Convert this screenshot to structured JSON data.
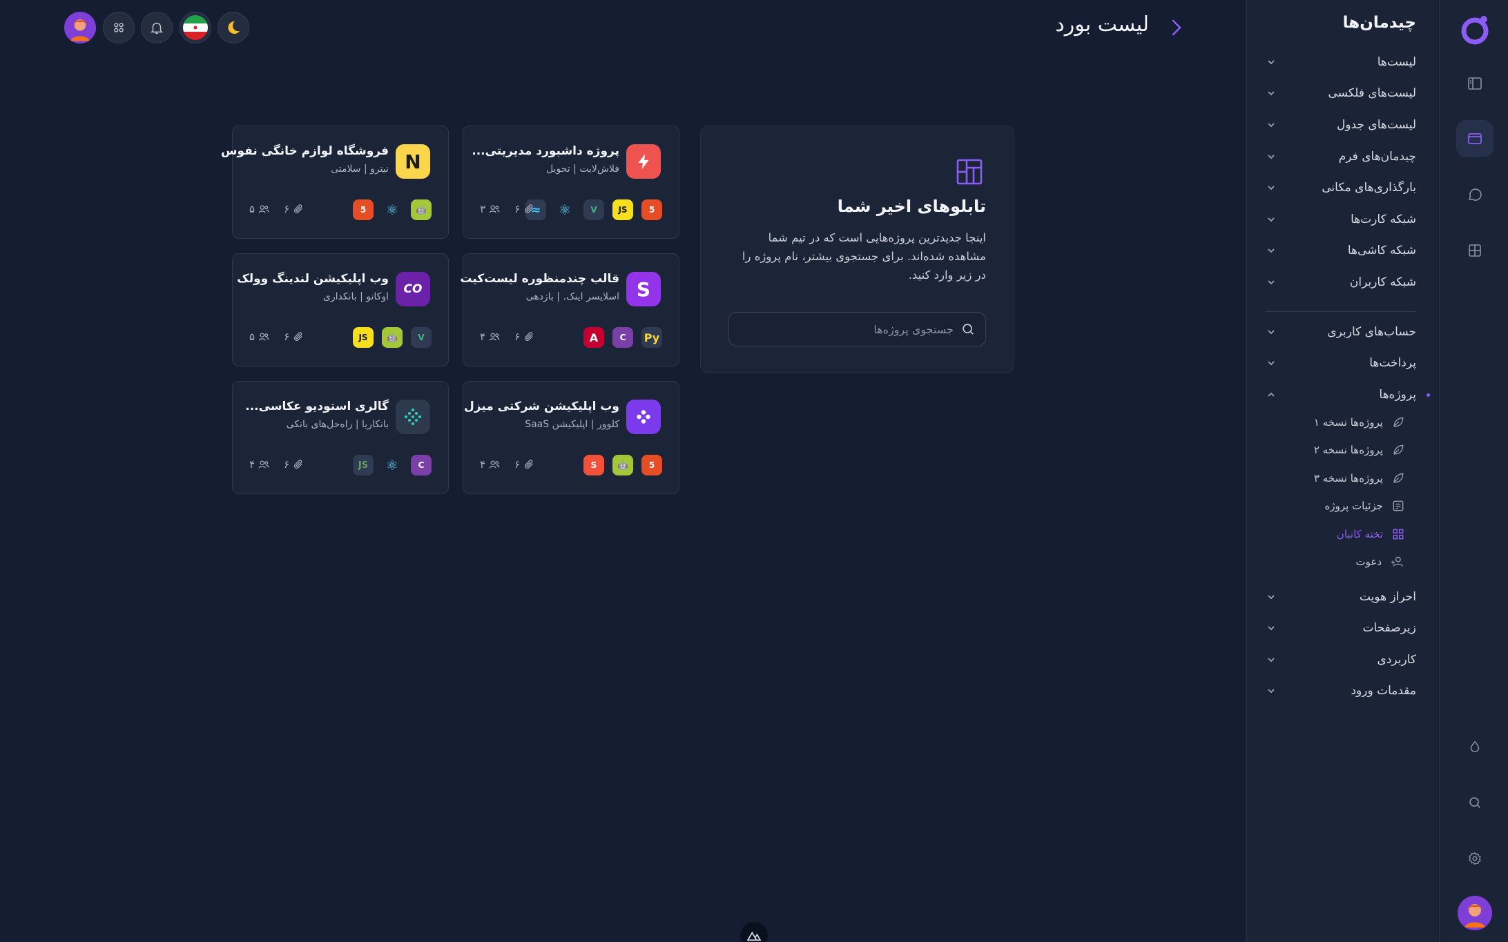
{
  "header": {
    "title": "لیست بورد"
  },
  "sidebar": {
    "title": "چیدمان‌ها",
    "groups_top": [
      {
        "label": "لیست‌ها"
      },
      {
        "label": "لیست‌های فلکسی"
      },
      {
        "label": "لیست‌های جدول"
      },
      {
        "label": "چیدمان‌های فرم"
      },
      {
        "label": "بارگذاری‌های مکانی"
      },
      {
        "label": "شبکه کارت‌ها"
      },
      {
        "label": "شبکه کاشی‌ها"
      },
      {
        "label": "شبکه کاربران"
      }
    ],
    "groups_bottom": [
      {
        "label": "حساب‌های کاربری"
      },
      {
        "label": "پرداخت‌ها"
      },
      {
        "label": "پروژه‌ها"
      }
    ],
    "project_subitems": [
      {
        "label": "پروژه‌ها نسخه ۱"
      },
      {
        "label": "پروژه‌ها نسخه ۲"
      },
      {
        "label": "پروژه‌ها نسخه ۳"
      },
      {
        "label": "جزئیات پروژه"
      },
      {
        "label": "تخته کانبان"
      },
      {
        "label": "دعوت"
      }
    ],
    "groups_tail": [
      {
        "label": "احراز هویت"
      },
      {
        "label": "زیرصفحات"
      },
      {
        "label": "کاربردی"
      },
      {
        "label": "مقدمات ورود"
      }
    ]
  },
  "info_card": {
    "title": "تابلوهای اخیر شما",
    "description": "اینجا جدیدترین پروژه‌هایی است که در تیم شما مشاهده شده‌اند. برای جستجوی بیشتر، نام پروژه را در زیر وارد کنید.",
    "search_placeholder": "جستجوی پروژه‌ها"
  },
  "projects": [
    {
      "title": "پروژه داشبورد مدیریتی...",
      "subtitle": "فلاش‌لایت | تحویل",
      "logo_text": "⚡",
      "logo_bg": "#ef5350",
      "attachments": "۶",
      "members": "۳"
    },
    {
      "title": "فروشگاه لوازم خانگی نفوس",
      "subtitle": "نیترو | سلامتی",
      "logo_text": "N",
      "logo_bg": "#fbd54a",
      "attachments": "۶",
      "members": "۵"
    },
    {
      "title": "قالب چندمنظوره لیست‌کیت",
      "subtitle": "اسلایسر اینک. | بازدهی",
      "logo_text": "S",
      "logo_bg": "#9333ea",
      "attachments": "۶",
      "members": "۴"
    },
    {
      "title": "وب اپلیکیشن لندینگ وولک",
      "subtitle": "اوکانو | بانکداری",
      "logo_text": "CO",
      "logo_bg": "#6b21a8",
      "attachments": "۶",
      "members": "۵"
    },
    {
      "title": "وب اپلیکیشن شرکتی میزل",
      "subtitle": "کلوور | اپلیکیشن SaaS",
      "logo_text": "✤",
      "logo_bg": "#7c3aed",
      "attachments": "۶",
      "members": "۴"
    },
    {
      "title": "گالری استودیو عکاسی...",
      "subtitle": "بانکاریا | راه‌حل‌های بانکی",
      "logo_text": "⁘",
      "logo_bg": "#2d3a4d",
      "attachments": "۶",
      "members": "۴"
    }
  ],
  "colors": {
    "accent": "#8b5cf6",
    "background": "#151d32",
    "panel": "#1b2336"
  }
}
